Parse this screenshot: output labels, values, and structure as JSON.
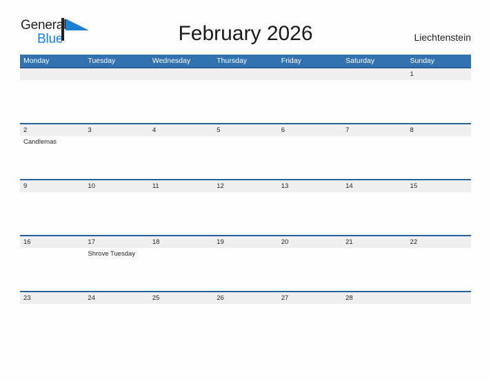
{
  "brand": {
    "name_part1": "General",
    "name_part2": "Blue",
    "flag_icon": "flag-triangle-icon",
    "pole_color": "#231f20",
    "flag_color": "#1b7fd4",
    "blue_text_color": "#1b7fd4"
  },
  "header": {
    "title": "February 2026",
    "region": "Liechtenstein"
  },
  "colors": {
    "header_row_bg": "#3272b0",
    "week_rule": "#2a6099",
    "date_band_bg": "#efefef",
    "page_bg": "#fdfdfe",
    "text": "#231f20"
  },
  "calendar": {
    "weekday_headers": [
      "Monday",
      "Tuesday",
      "Wednesday",
      "Thursday",
      "Friday",
      "Saturday",
      "Sunday"
    ],
    "weeks": [
      {
        "days": [
          {
            "date": "",
            "event": ""
          },
          {
            "date": "",
            "event": ""
          },
          {
            "date": "",
            "event": ""
          },
          {
            "date": "",
            "event": ""
          },
          {
            "date": "",
            "event": ""
          },
          {
            "date": "",
            "event": ""
          },
          {
            "date": "1",
            "event": ""
          }
        ]
      },
      {
        "days": [
          {
            "date": "2",
            "event": "Candlemas"
          },
          {
            "date": "3",
            "event": ""
          },
          {
            "date": "4",
            "event": ""
          },
          {
            "date": "5",
            "event": ""
          },
          {
            "date": "6",
            "event": ""
          },
          {
            "date": "7",
            "event": ""
          },
          {
            "date": "8",
            "event": ""
          }
        ]
      },
      {
        "days": [
          {
            "date": "9",
            "event": ""
          },
          {
            "date": "10",
            "event": ""
          },
          {
            "date": "11",
            "event": ""
          },
          {
            "date": "12",
            "event": ""
          },
          {
            "date": "13",
            "event": ""
          },
          {
            "date": "14",
            "event": ""
          },
          {
            "date": "15",
            "event": ""
          }
        ]
      },
      {
        "days": [
          {
            "date": "16",
            "event": ""
          },
          {
            "date": "17",
            "event": "Shrove Tuesday"
          },
          {
            "date": "18",
            "event": ""
          },
          {
            "date": "19",
            "event": ""
          },
          {
            "date": "20",
            "event": ""
          },
          {
            "date": "21",
            "event": ""
          },
          {
            "date": "22",
            "event": ""
          }
        ]
      },
      {
        "days": [
          {
            "date": "23",
            "event": ""
          },
          {
            "date": "24",
            "event": ""
          },
          {
            "date": "25",
            "event": ""
          },
          {
            "date": "26",
            "event": ""
          },
          {
            "date": "27",
            "event": ""
          },
          {
            "date": "28",
            "event": ""
          },
          {
            "date": "",
            "event": ""
          }
        ]
      }
    ]
  }
}
